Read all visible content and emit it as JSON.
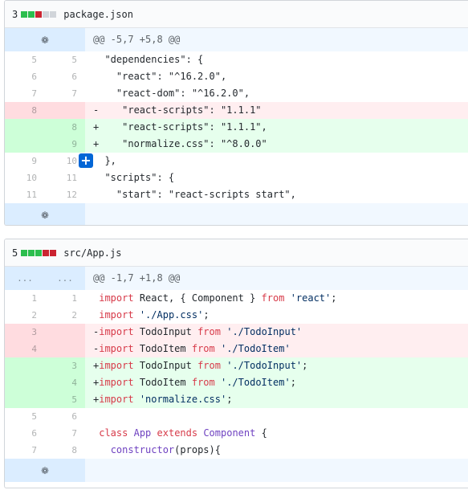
{
  "files": [
    {
      "changes": "3",
      "diffstat": [
        "add",
        "add",
        "del",
        "neu",
        "neu"
      ],
      "name": "package.json",
      "hunk": "@@ -5,7 +5,8 @@",
      "lines": [
        {
          "type": "ctx",
          "old": "5",
          "new": "5",
          "tokens": [
            {
              "t": "  \"dependencies\": {"
            }
          ]
        },
        {
          "type": "ctx",
          "old": "6",
          "new": "6",
          "tokens": [
            {
              "t": "    \"react\": \"^16.2.0\","
            }
          ]
        },
        {
          "type": "ctx",
          "old": "7",
          "new": "7",
          "tokens": [
            {
              "t": "    \"react-dom\": \"^16.2.0\","
            }
          ]
        },
        {
          "type": "del",
          "old": "8",
          "new": "",
          "tokens": [
            {
              "t": "-    \"react-scripts\": \"1.1.1\""
            }
          ]
        },
        {
          "type": "add",
          "old": "",
          "new": "8",
          "tokens": [
            {
              "t": "+    \"react-scripts\": \"1.1.1\","
            }
          ]
        },
        {
          "type": "add",
          "old": "",
          "new": "9",
          "tokens": [
            {
              "t": "+    \"normalize.css\": \"^8.0.0\""
            }
          ]
        },
        {
          "type": "ctx",
          "old": "9",
          "new": "10",
          "plus": "+",
          "tokens": [
            {
              "t": "  },"
            }
          ]
        },
        {
          "type": "ctx",
          "old": "10",
          "new": "11",
          "tokens": [
            {
              "t": "  \"scripts\": {"
            }
          ]
        },
        {
          "type": "ctx",
          "old": "11",
          "new": "12",
          "tokens": [
            {
              "t": "    \"start\": \"react-scripts start\","
            }
          ]
        }
      ]
    },
    {
      "changes": "5",
      "diffstat": [
        "add",
        "add",
        "add",
        "del",
        "del"
      ],
      "name": "src/App.js",
      "hunk": "@@ -1,7 +1,8 @@",
      "hunk_dots": "...",
      "lines": [
        {
          "type": "ctx",
          "old": "1",
          "new": "1",
          "tokens": [
            {
              "t": " "
            },
            {
              "t": "import",
              "c": "kw"
            },
            {
              "t": " React, { Component } "
            },
            {
              "t": "from",
              "c": "kw"
            },
            {
              "t": " "
            },
            {
              "t": "'react'",
              "c": "str"
            },
            {
              "t": ";"
            }
          ]
        },
        {
          "type": "ctx",
          "old": "2",
          "new": "2",
          "tokens": [
            {
              "t": " "
            },
            {
              "t": "import",
              "c": "kw"
            },
            {
              "t": " "
            },
            {
              "t": "'./App.css'",
              "c": "str"
            },
            {
              "t": ";"
            }
          ]
        },
        {
          "type": "del",
          "old": "3",
          "new": "",
          "tokens": [
            {
              "t": "-"
            },
            {
              "t": "import",
              "c": "kw"
            },
            {
              "t": " TodoInput "
            },
            {
              "t": "from",
              "c": "kw"
            },
            {
              "t": " "
            },
            {
              "t": "'./TodoInput'",
              "c": "str"
            }
          ]
        },
        {
          "type": "del",
          "old": "4",
          "new": "",
          "tokens": [
            {
              "t": "-"
            },
            {
              "t": "import",
              "c": "kw"
            },
            {
              "t": " TodoItem "
            },
            {
              "t": "from",
              "c": "kw"
            },
            {
              "t": " "
            },
            {
              "t": "'./TodoItem'",
              "c": "str"
            }
          ]
        },
        {
          "type": "add",
          "old": "",
          "new": "3",
          "tokens": [
            {
              "t": "+"
            },
            {
              "t": "import",
              "c": "kw"
            },
            {
              "t": " TodoInput "
            },
            {
              "t": "from",
              "c": "kw"
            },
            {
              "t": " "
            },
            {
              "t": "'./TodoInput'",
              "c": "str"
            },
            {
              "t": ";"
            }
          ]
        },
        {
          "type": "add",
          "old": "",
          "new": "4",
          "tokens": [
            {
              "t": "+"
            },
            {
              "t": "import",
              "c": "kw"
            },
            {
              "t": " TodoItem "
            },
            {
              "t": "from",
              "c": "kw"
            },
            {
              "t": " "
            },
            {
              "t": "'./TodoItem'",
              "c": "str"
            },
            {
              "t": ";"
            }
          ]
        },
        {
          "type": "add",
          "old": "",
          "new": "5",
          "tokens": [
            {
              "t": "+"
            },
            {
              "t": "import",
              "c": "kw"
            },
            {
              "t": " "
            },
            {
              "t": "'normalize.css'",
              "c": "str"
            },
            {
              "t": ";"
            }
          ]
        },
        {
          "type": "ctx",
          "old": "5",
          "new": "6",
          "tokens": [
            {
              "t": ""
            }
          ]
        },
        {
          "type": "ctx",
          "old": "6",
          "new": "7",
          "tokens": [
            {
              "t": " "
            },
            {
              "t": "class",
              "c": "kw"
            },
            {
              "t": " "
            },
            {
              "t": "App",
              "c": "ent"
            },
            {
              "t": " "
            },
            {
              "t": "extends",
              "c": "kw"
            },
            {
              "t": " "
            },
            {
              "t": "Component",
              "c": "ent"
            },
            {
              "t": " {"
            }
          ]
        },
        {
          "type": "ctx",
          "old": "7",
          "new": "8",
          "tokens": [
            {
              "t": "   "
            },
            {
              "t": "constructor",
              "c": "ent"
            },
            {
              "t": "(props){"
            }
          ]
        }
      ]
    }
  ],
  "icons": {
    "expand": "unfold-icon",
    "expand_glyph": "❁"
  },
  "colors": {
    "add_sq": "#2cbe4e",
    "del_sq": "#cb2431",
    "neutral_sq": "#d1d5da",
    "expand_btn": "#0366d6"
  }
}
